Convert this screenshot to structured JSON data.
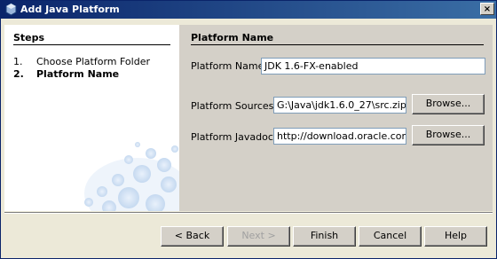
{
  "window": {
    "title": "Add Java Platform",
    "close_glyph": "×"
  },
  "steps": {
    "heading": "Steps",
    "items": [
      {
        "num": "1.",
        "label": "Choose Platform Folder"
      },
      {
        "num": "2.",
        "label": "Platform Name"
      }
    ]
  },
  "panel": {
    "heading": "Platform Name",
    "platform_name_label": "Platform Name:",
    "platform_name_value": "JDK 1.6-FX-enabled",
    "sources_label": "Platform Sources:",
    "sources_value": "G:\\Java\\jdk1.6.0_27\\src.zip",
    "javadoc_label": "Platform Javadoc:",
    "javadoc_value": "http://download.oracle.com/ja",
    "browse_label": "Browse..."
  },
  "buttons": {
    "back": "< Back",
    "next": "Next >",
    "finish": "Finish",
    "cancel": "Cancel",
    "help": "Help"
  }
}
